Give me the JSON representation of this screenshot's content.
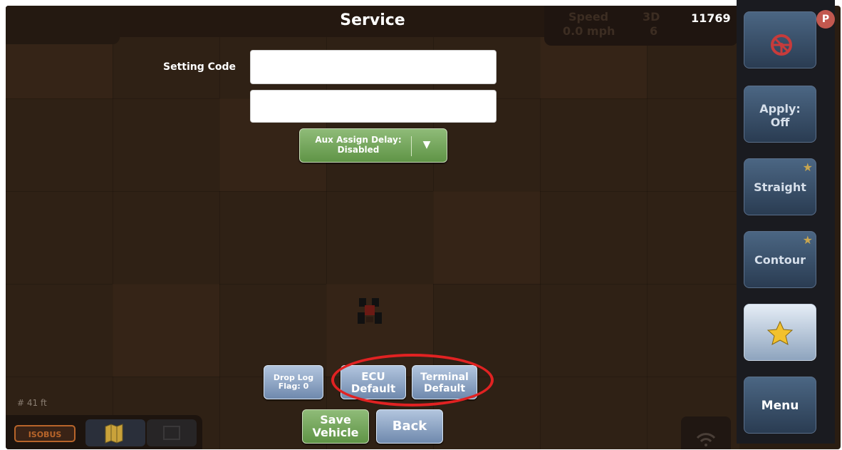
{
  "header": {
    "title": "Service",
    "speed_label": "Speed",
    "speed_value": "0.0 mph",
    "gps_mode": "3D",
    "gps_satellites": "6",
    "counter": "11769"
  },
  "form": {
    "setting_code_label": "Setting Code",
    "setting_code_value": "",
    "second_field_value": "",
    "aux_assign_delay_line1": "Aux Assign Delay:",
    "aux_assign_delay_line2": "Disabled"
  },
  "buttons": {
    "drop_log_line1": "Drop Log",
    "drop_log_line2": "Flag: 0",
    "ecu_default_line1": "ECU",
    "ecu_default_line2": "Default",
    "terminal_default_line1": "Terminal",
    "terminal_default_line2": "Default",
    "save_vehicle_line1": "Save",
    "save_vehicle_line2": "Vehicle",
    "back": "Back"
  },
  "bottom_bar": {
    "scale": "41 ft",
    "iso_label": "ISOBUS"
  },
  "side_panel": {
    "apply_line1": "Apply:",
    "apply_line2": "Off",
    "straight": "Straight",
    "contour": "Contour",
    "menu": "Menu",
    "badge": "P"
  },
  "colors": {
    "background": "#2f2115",
    "green_button": "#6fa055",
    "blue_button": "#7f98b9",
    "highlight": "#e12222",
    "side_button": "#3b5571"
  },
  "icons": {
    "steer": "steering-wheel-icon",
    "favorite": "star-icon",
    "dropdown": "triangle-down-icon",
    "wifi": "wifi-icon",
    "map": "map-icon",
    "vehicle": "tractor-icon"
  }
}
